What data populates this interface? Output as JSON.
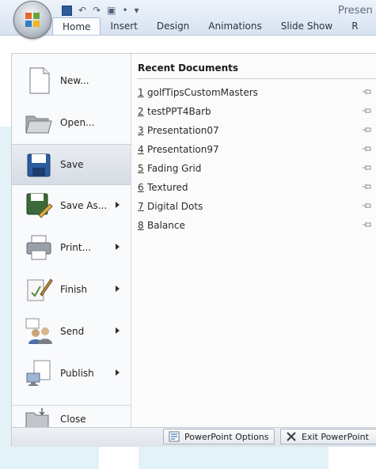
{
  "window": {
    "title": "Presen",
    "tabs": [
      "Home",
      "Insert",
      "Design",
      "Animations",
      "Slide Show",
      "R"
    ]
  },
  "menu": {
    "commands": [
      {
        "label": "New...",
        "key": "N",
        "icon": "new-document-icon",
        "submenu": false
      },
      {
        "label": "Open...",
        "key": "O",
        "icon": "open-folder-icon",
        "submenu": false
      },
      {
        "label": "Save",
        "key": "S",
        "icon": "save-floppy-icon",
        "submenu": false,
        "highlighted": true
      },
      {
        "label": "Save As...",
        "key": "A",
        "icon": "save-as-icon",
        "submenu": true
      },
      {
        "label": "Print...",
        "key": "P",
        "icon": "printer-icon",
        "submenu": true
      },
      {
        "label": "Finish",
        "key": "E",
        "icon": "finish-pen-icon",
        "submenu": true
      },
      {
        "label": "Send",
        "key": "D",
        "icon": "send-people-icon",
        "submenu": true
      },
      {
        "label": "Publish",
        "key": "U",
        "icon": "publish-icon",
        "submenu": true
      },
      {
        "label": "Close",
        "key": "C",
        "icon": "close-folder-icon",
        "submenu": false
      }
    ],
    "recent_documents": {
      "heading": "Recent Documents",
      "items": [
        {
          "number": "1",
          "name": "golfTipsCustomMasters"
        },
        {
          "number": "2",
          "name": "testPPT4Barb"
        },
        {
          "number": "3",
          "name": "Presentation07"
        },
        {
          "number": "4",
          "name": "Presentation97"
        },
        {
          "number": "5",
          "name": "Fading Grid"
        },
        {
          "number": "6",
          "name": "Textured"
        },
        {
          "number": "7",
          "name": "Digital Dots"
        },
        {
          "number": "8",
          "name": "Balance"
        }
      ]
    },
    "footer": {
      "options_label": "PowerPoint Options",
      "exit_label": "Exit PowerPoint"
    }
  },
  "colors": {
    "ribbon": "#d7e2f1",
    "menu_background": "#fbfbfc",
    "highlight": "#d6dce4",
    "background_accent": "#0d97b8"
  }
}
